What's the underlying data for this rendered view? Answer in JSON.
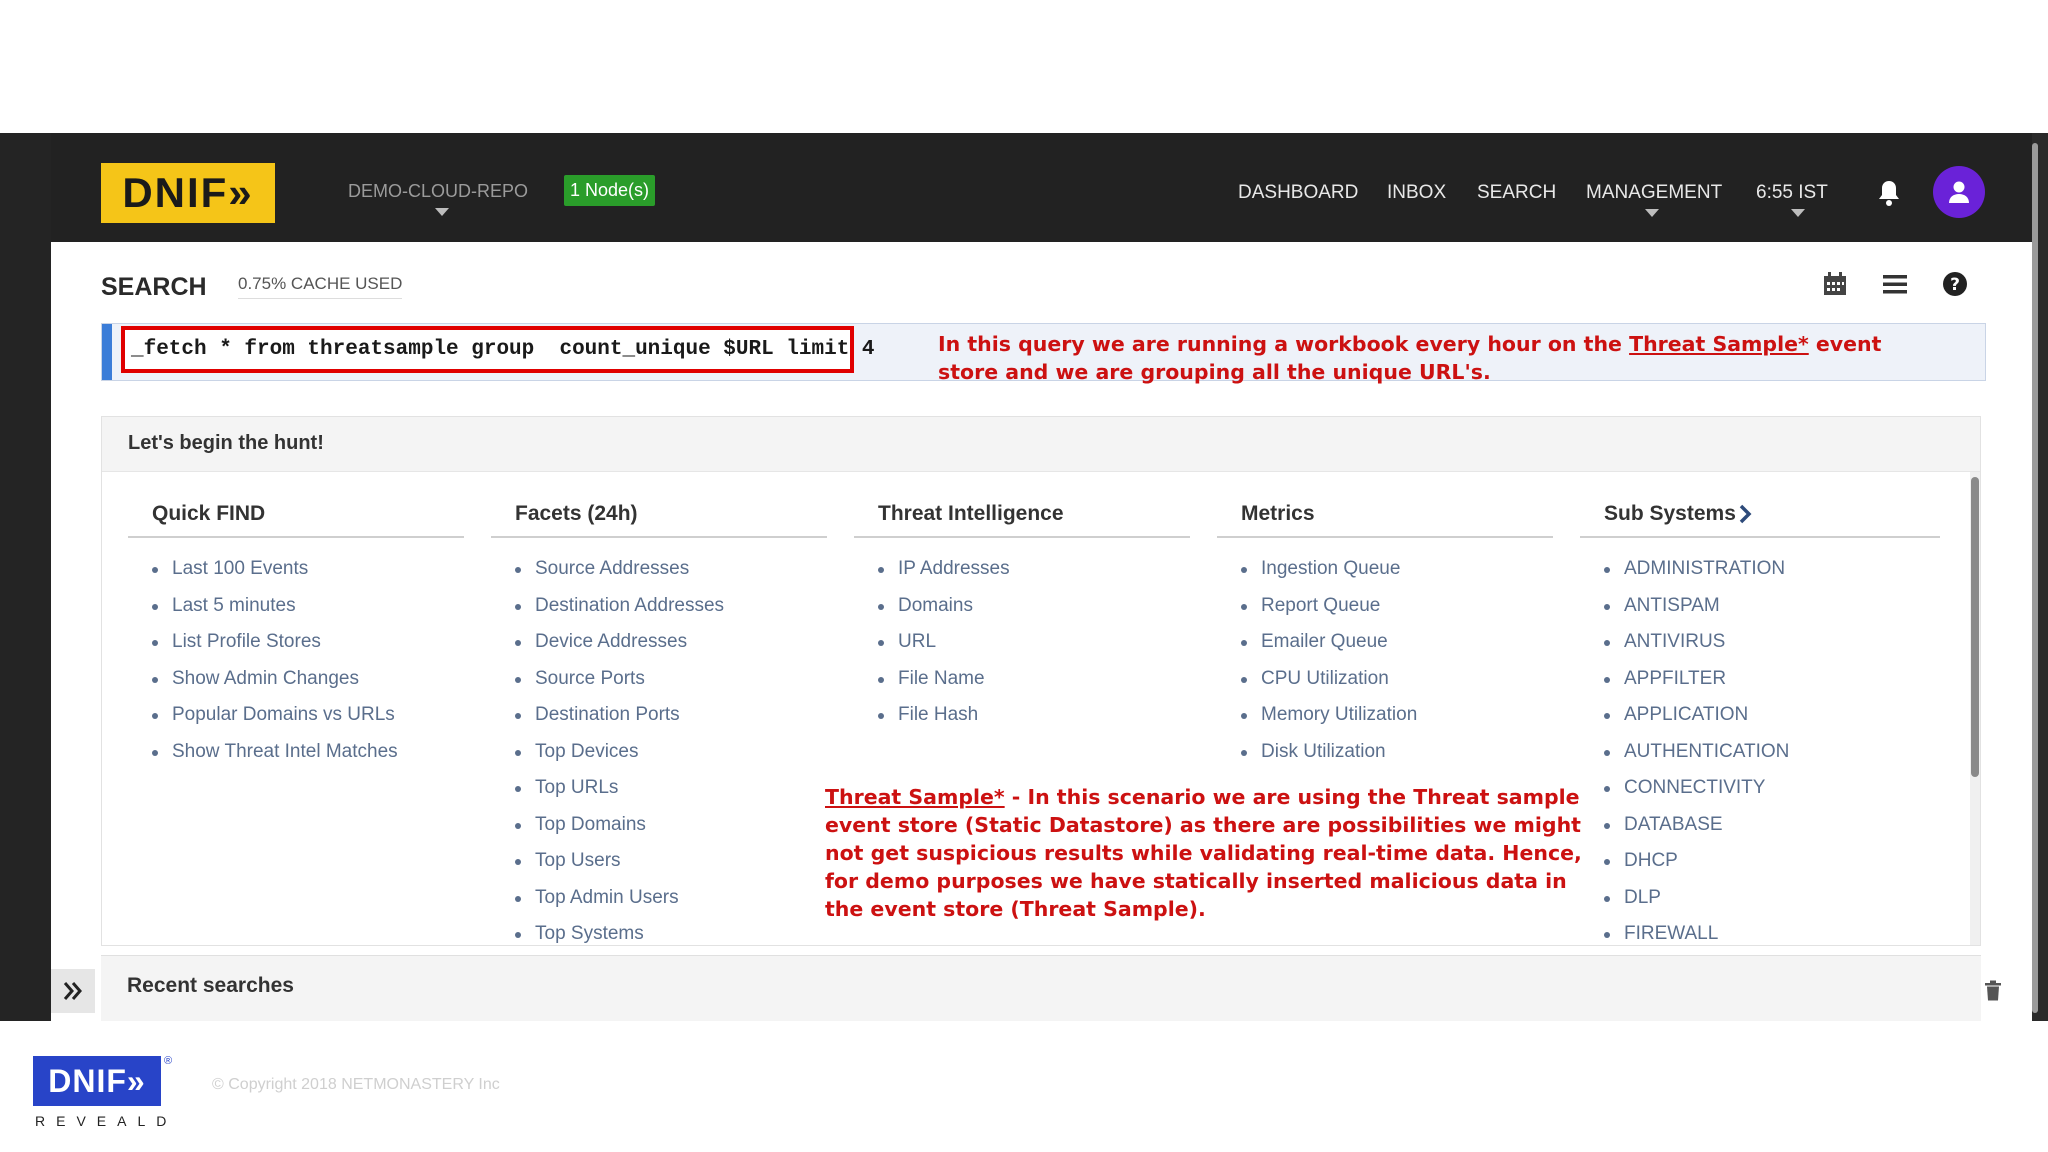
{
  "header": {
    "logo_text": "DNIF»",
    "repo": "DEMO-CLOUD-REPO",
    "nodes_badge": "1 Node(s)",
    "nav": [
      "DASHBOARD",
      "INBOX",
      "SEARCH",
      "MANAGEMENT",
      "6:55 IST"
    ],
    "icons": [
      "bell-icon",
      "user-icon"
    ]
  },
  "search": {
    "title": "SEARCH",
    "cache": "0.75% CACHE USED",
    "query": "_fetch * from threatsample group  count_unique $URL limit 4",
    "toolbar_icons": [
      "calendar-icon",
      "menu-icon",
      "help-icon"
    ]
  },
  "annotations": {
    "query_note_before": "In this query we are running a workbook every hour on the ",
    "query_note_link": "Threat Sample*",
    "query_note_after": " event store and we are grouping all the unique URL's.",
    "scenario_link": "Threat Sample*",
    "scenario_text": " -  In this scenario we are using the Threat sample event store (Static Datastore) as there are possibilities we might not get suspicious results while validating real-time data. Hence, for demo purposes we have statically inserted malicious data in the event store (Threat Sample)."
  },
  "panel": {
    "heading": "Let's begin the hunt!",
    "columns": [
      {
        "title": "Quick FIND",
        "items": [
          "Last 100 Events",
          "Last 5 minutes",
          "List Profile Stores",
          "Show Admin Changes",
          "Popular Domains vs URLs",
          "Show Threat Intel Matches"
        ]
      },
      {
        "title": "Facets (24h)",
        "items": [
          "Source Addresses",
          "Destination Addresses",
          "Device Addresses",
          "Source Ports",
          "Destination Ports",
          "Top Devices",
          "Top URLs",
          "Top Domains",
          "Top Users",
          "Top Admin Users",
          "Top Systems"
        ]
      },
      {
        "title": "Threat Intelligence",
        "items": [
          "IP Addresses",
          "Domains",
          "URL",
          "File Name",
          "File Hash"
        ]
      },
      {
        "title": "Metrics",
        "items": [
          "Ingestion Queue",
          "Report Queue",
          "Emailer Queue",
          "CPU Utilization",
          "Memory Utilization",
          "Disk Utilization"
        ]
      },
      {
        "title": "Sub Systems",
        "items": [
          "ADMINISTRATION",
          "ANTISPAM",
          "ANTIVIRUS",
          "APPFILTER",
          "APPLICATION",
          "AUTHENTICATION",
          "CONNECTIVITY",
          "DATABASE",
          "DHCP",
          "DLP",
          "FIREWALL"
        ]
      }
    ]
  },
  "recent": {
    "title": "Recent searches"
  },
  "footer": {
    "logo_text": "DNIF»",
    "reg_mark": "®",
    "tagline": "REVEALD",
    "copyright": "© Copyright 2018 NETMONASTERY Inc"
  },
  "colors": {
    "brand_yellow": "#f5c518",
    "accent_blue": "#3b7dd8",
    "annotation_red": "#cc1111",
    "nodes_green": "#2a9d2a",
    "avatar_purple": "#6a22d8"
  }
}
